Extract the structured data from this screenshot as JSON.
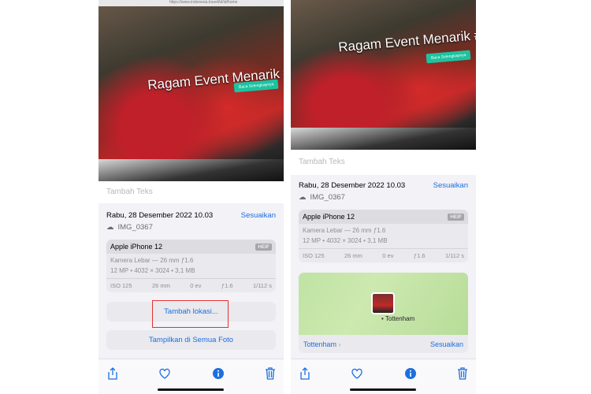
{
  "photo": {
    "url": "https://www.indonesia.travel/id/id/home",
    "headline": "Ragam Event Menarik #Di",
    "cta": "Baca Selengkapnya"
  },
  "screens": [
    {
      "caption_placeholder": "Tambah Teks",
      "date": "Rabu, 28 Desember 2022 10.03",
      "adjust": "Sesuaikan",
      "filename": "IMG_0367",
      "device": "Apple iPhone 12",
      "format": "HEIF",
      "lens": "Kamera Lebar — 26 mm ƒ1.6",
      "specs": "12 MP • 4032 × 3024 • 3,1 MB",
      "exif": [
        "ISO 125",
        "26 mm",
        "0 ev",
        "ƒ1.6",
        "1/112 s"
      ],
      "add_location": "Tambah lokasi...",
      "show_all": "Tampilkan di Semua Foto"
    },
    {
      "caption_placeholder": "Tambah Teks",
      "date": "Rabu, 28 Desember 2022 10.03",
      "adjust": "Sesuaikan",
      "filename": "IMG_0367",
      "device": "Apple iPhone 12",
      "format": "HEIF",
      "lens": "Kamera Lebar — 26 mm ƒ1.6",
      "specs": "12 MP • 4032 × 3024 • 3,1 MB",
      "exif": [
        "ISO 125",
        "26 mm",
        "0 ev",
        "ƒ1.6",
        "1/112 s"
      ],
      "map_label": "Tottenham",
      "location": "Tottenham",
      "location_adjust": "Sesuaikan"
    }
  ],
  "colors": {
    "accent": "#1d6fe0",
    "highlight": "#e53030"
  },
  "toolbar": {
    "icons": [
      "share-icon",
      "heart-icon",
      "info-icon",
      "trash-icon"
    ]
  }
}
